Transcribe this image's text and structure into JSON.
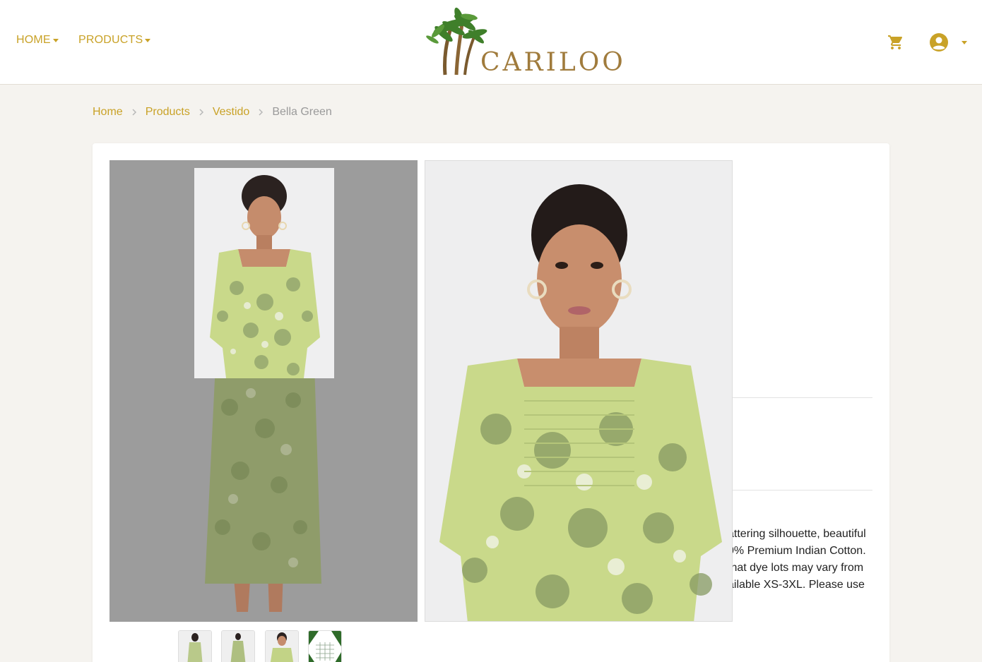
{
  "header": {
    "nav": [
      {
        "label": "HOME"
      },
      {
        "label": "PRODUCTS"
      }
    ],
    "logo_text": "CARILOO",
    "cart_icon": "cart-icon",
    "account_icon": "account-circle-icon",
    "accent_color": "#c9a227"
  },
  "breadcrumb": {
    "items": [
      "Home",
      "Products",
      "Vestido"
    ],
    "current": "Bella Green"
  },
  "product": {
    "description_lines": [
      "attering silhouette, beautiful",
      "0% Premium Indian Cotton.",
      "that dye lots may vary from",
      "ailable XS-3XL. Please use"
    ],
    "thumbnails": [
      "dress-front",
      "dress-full",
      "dress-closeup",
      "size-chart"
    ]
  }
}
